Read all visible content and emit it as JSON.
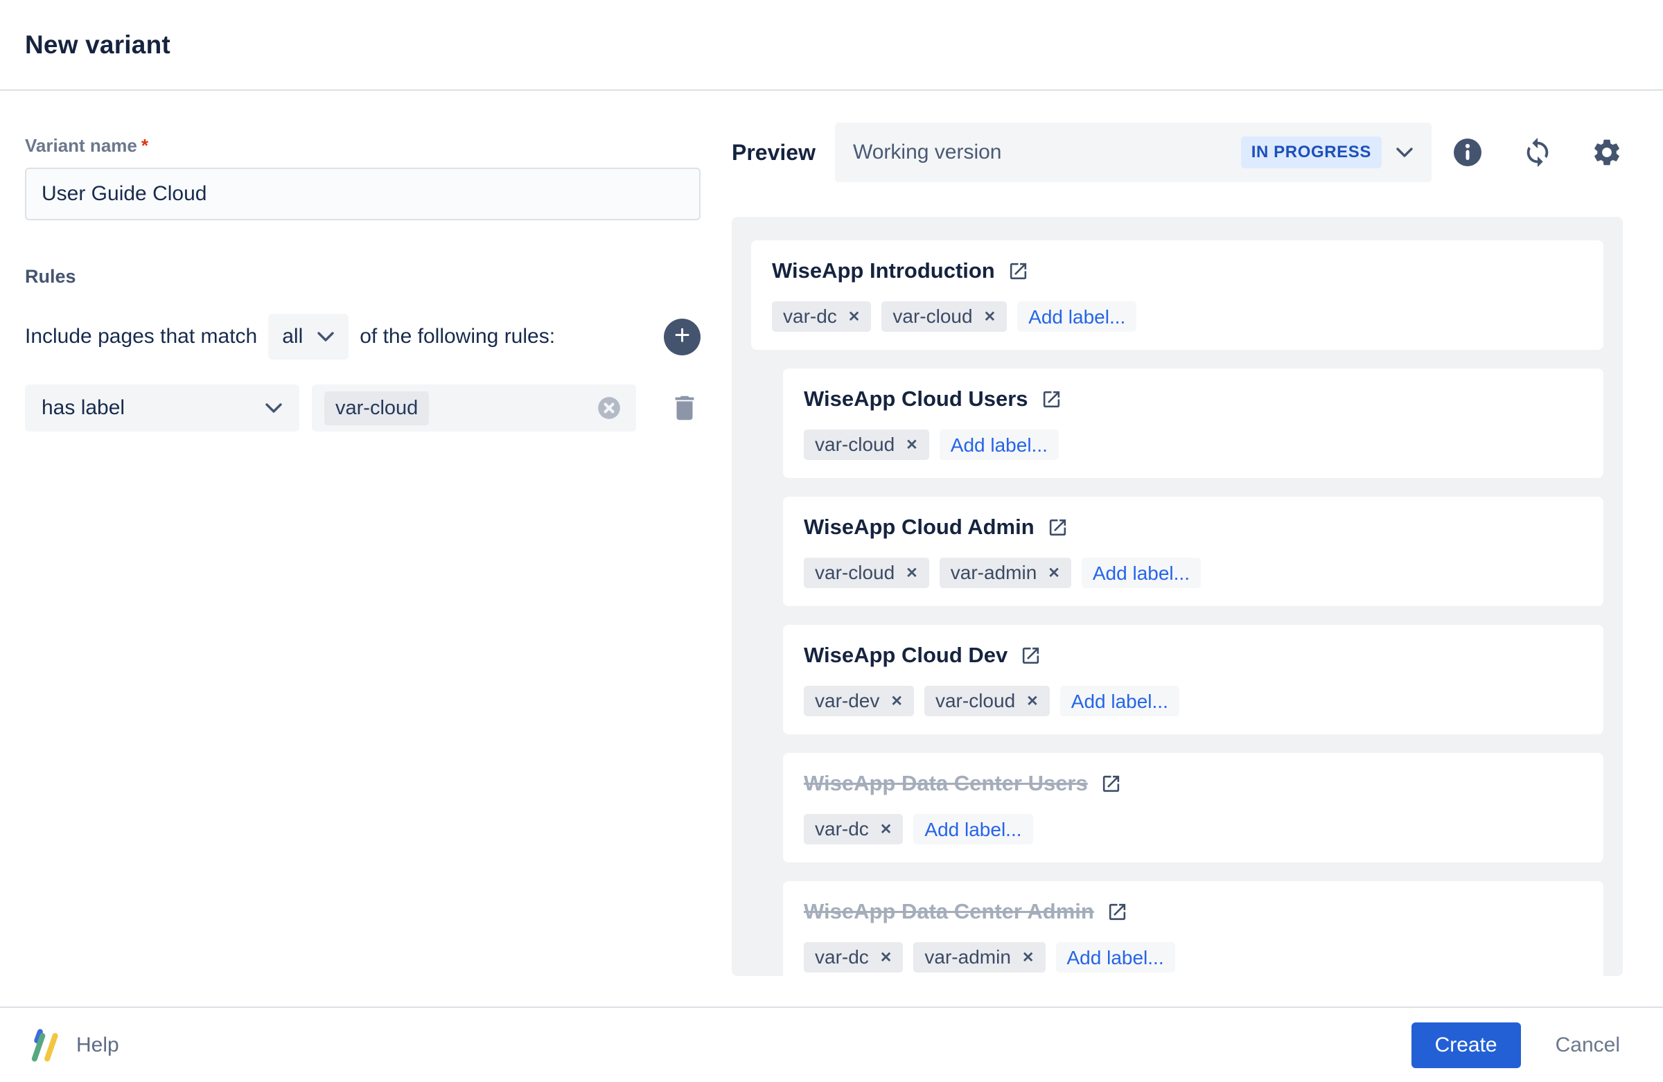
{
  "header": {
    "title": "New variant"
  },
  "form": {
    "variant_name": {
      "label": "Variant name",
      "required_mark": "*",
      "value": "User Guide Cloud"
    },
    "rules": {
      "heading": "Rules",
      "match_prefix": "Include pages that match",
      "match_selected": "all",
      "match_suffix": "of the following rules:",
      "rows": [
        {
          "condition": "has label",
          "value": "var-cloud"
        }
      ]
    }
  },
  "preview": {
    "label": "Preview",
    "version_selector": {
      "value": "Working version",
      "badge": "IN PROGRESS"
    },
    "pages": [
      {
        "title": "WiseApp Introduction",
        "level": 0,
        "excluded": false,
        "labels": [
          "var-dc",
          "var-cloud"
        ]
      },
      {
        "title": "WiseApp Cloud Users",
        "level": 1,
        "excluded": false,
        "labels": [
          "var-cloud"
        ]
      },
      {
        "title": "WiseApp Cloud Admin",
        "level": 1,
        "excluded": false,
        "labels": [
          "var-cloud",
          "var-admin"
        ]
      },
      {
        "title": "WiseApp Cloud Dev",
        "level": 1,
        "excluded": false,
        "labels": [
          "var-dev",
          "var-cloud"
        ]
      },
      {
        "title": "WiseApp Data Center Users",
        "level": 1,
        "excluded": true,
        "labels": [
          "var-dc"
        ]
      },
      {
        "title": "WiseApp Data Center Admin",
        "level": 1,
        "excluded": true,
        "labels": [
          "var-dc",
          "var-admin"
        ]
      }
    ],
    "add_label_text": "Add label...",
    "remove_glyph": "✕"
  },
  "footer": {
    "help": "Help",
    "create": "Create",
    "cancel": "Cancel"
  },
  "icons": {
    "add_rule": "plus-icon",
    "plus_glyph": "+",
    "rule_delete": "trash-icon",
    "rule_clear": "clear-icon",
    "preview_info": "info-icon",
    "preview_refresh": "refresh-icon",
    "preview_settings": "gear-icon",
    "page_open": "external-link-icon",
    "dropdown": "chevron-down-icon",
    "brand": "k15t-logo"
  },
  "colors": {
    "accent_blue": "#2360D6",
    "link_blue": "#2465E8",
    "badge_bg": "#DEEBFF",
    "badge_text": "#1D4FBB",
    "excluded_text": "#A5ADBA",
    "panel_bg": "#F1F2F4",
    "required_red": "#DE350B",
    "slate_icon": "#44546F"
  }
}
